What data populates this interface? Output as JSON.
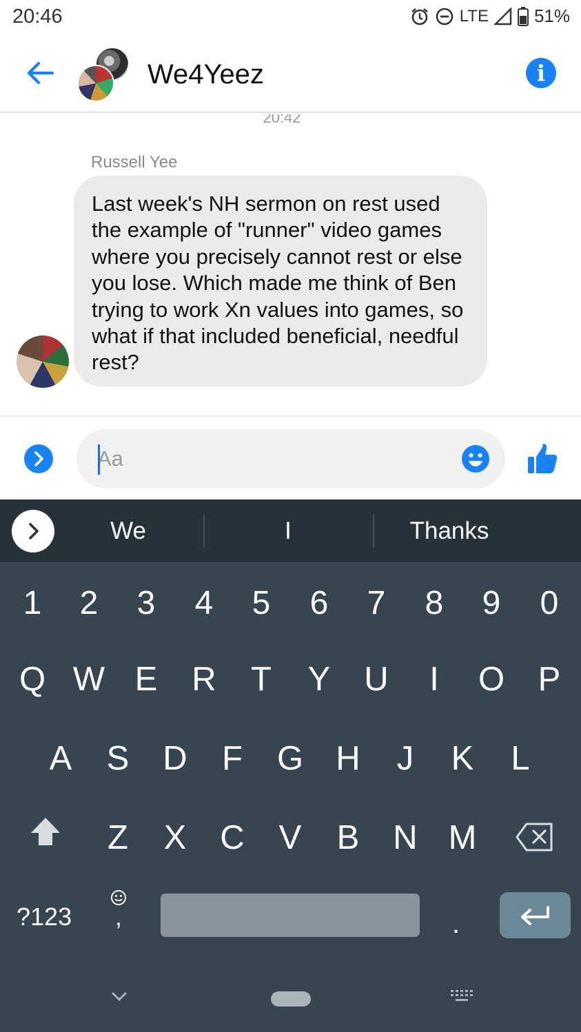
{
  "status_bar": {
    "time": "20:46",
    "network": "LTE",
    "battery": "51%",
    "icons": [
      "alarm-icon",
      "do-not-disturb-icon",
      "signal-icon",
      "battery-icon"
    ]
  },
  "header": {
    "title": "We4Yeez",
    "back_icon": "arrow-left-icon",
    "info_icon": "info-icon"
  },
  "messages": {
    "timestamp": "20:42",
    "items": [
      {
        "sender": "Russell Yee",
        "text": "Last week's NH sermon on rest used the example of \"runner\" video games where you precisely cannot rest or else you lose. Which made me think of Ben trying to work Xn values into games, so what if that included beneficial, needful rest?"
      }
    ]
  },
  "composer": {
    "placeholder": "Aa",
    "value": ""
  },
  "keyboard": {
    "suggestions": [
      "We",
      "I",
      "Thanks"
    ],
    "number_row": [
      "1",
      "2",
      "3",
      "4",
      "5",
      "6",
      "7",
      "8",
      "9",
      "0"
    ],
    "row1": [
      "Q",
      "W",
      "E",
      "R",
      "T",
      "Y",
      "U",
      "I",
      "O",
      "P"
    ],
    "row2": [
      "A",
      "S",
      "D",
      "F",
      "G",
      "H",
      "J",
      "K",
      "L"
    ],
    "row3": [
      "Z",
      "X",
      "C",
      "V",
      "B",
      "N",
      "M"
    ],
    "symbols_label": "?123",
    "comma": ",",
    "period": "."
  },
  "colors": {
    "accent": "#1a82f7",
    "bubble": "#ebebeb",
    "keyboard_bg": "#36454f",
    "suggest_bg": "#263238"
  }
}
